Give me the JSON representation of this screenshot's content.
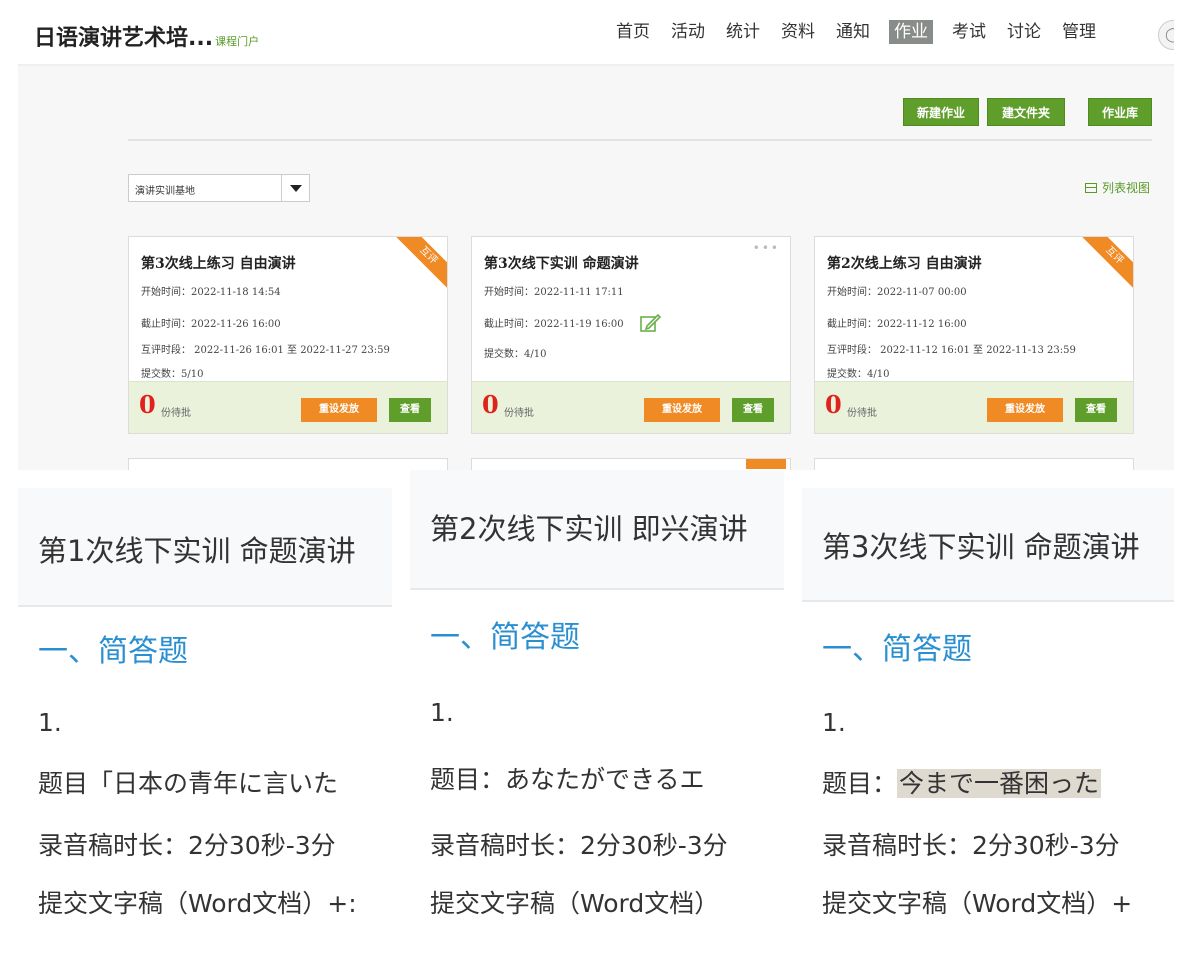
{
  "app": {
    "title": "日语演讲艺术培...",
    "subtitle": "课程门户"
  },
  "nav": [
    {
      "label": "首页"
    },
    {
      "label": "活动"
    },
    {
      "label": "统计"
    },
    {
      "label": "资料"
    },
    {
      "label": "通知"
    },
    {
      "label": "作业",
      "active": true
    },
    {
      "label": "考试"
    },
    {
      "label": "讨论"
    },
    {
      "label": "管理"
    }
  ],
  "toolbar": {
    "new_homework": "新建作业",
    "new_folder": "建文件夹",
    "homework_library": "作业库"
  },
  "filter": {
    "selected": "演讲实训基地",
    "list_view": "列表视图"
  },
  "cards": [
    {
      "title": "第3次线上练习 自由演讲",
      "tag": "互评",
      "start": "开始时间：2022-11-18 14:54",
      "end": "截止时间：2022-11-26 16:00",
      "peer": "互评时段：  2022-11-26 16:01 至 2022-11-27 23:59",
      "submitted": "提交数：5/10",
      "pending_count": "0",
      "pending_label": "份待批",
      "reset": "重设发放",
      "view": "查看"
    },
    {
      "title": "第3次线下实训 命题演讲",
      "start": "开始时间：2022-11-11 17:11",
      "end": "截止时间：2022-11-19 16:00",
      "submitted": "提交数：4/10",
      "pending_count": "0",
      "pending_label": "份待批",
      "reset": "重设发放",
      "view": "查看"
    },
    {
      "title": "第2次线上练习 自由演讲",
      "tag": "互评",
      "start": "开始时间：2022-11-07 00:00",
      "end": "截止时间：2022-11-12 16:00",
      "peer": "互评时段：  2022-11-12 16:01 至 2022-11-13 23:59",
      "submitted": "提交数：4/10",
      "pending_count": "0",
      "pending_label": "份待批",
      "reset": "重设发放",
      "view": "查看"
    }
  ],
  "phones": [
    {
      "title": "第1次线下实训 命题演讲",
      "section": "一、简答题",
      "num": "1.",
      "topic": "题目「日本の青年に言いた",
      "duration": "录音稿时长：2分30秒-3分",
      "submit": "提交文字稿（Word文档）+:"
    },
    {
      "title": "第2次线下实训 即兴演讲",
      "section": "一、简答题",
      "num": "1.",
      "topic": "题目：あなたができるエ",
      "duration": "录音稿时长：2分30秒-3分",
      "submit": "提交文字稿（Word文档）"
    },
    {
      "title": "第3次线下实训 命题演讲",
      "section": "一、简答题",
      "num": "1.",
      "topic_prefix": "题目：",
      "topic_highlight": "今まで一番困った",
      "duration": "录音稿时长：2分30秒-3分",
      "submit": "提交文字稿（Word文档）+"
    }
  ]
}
